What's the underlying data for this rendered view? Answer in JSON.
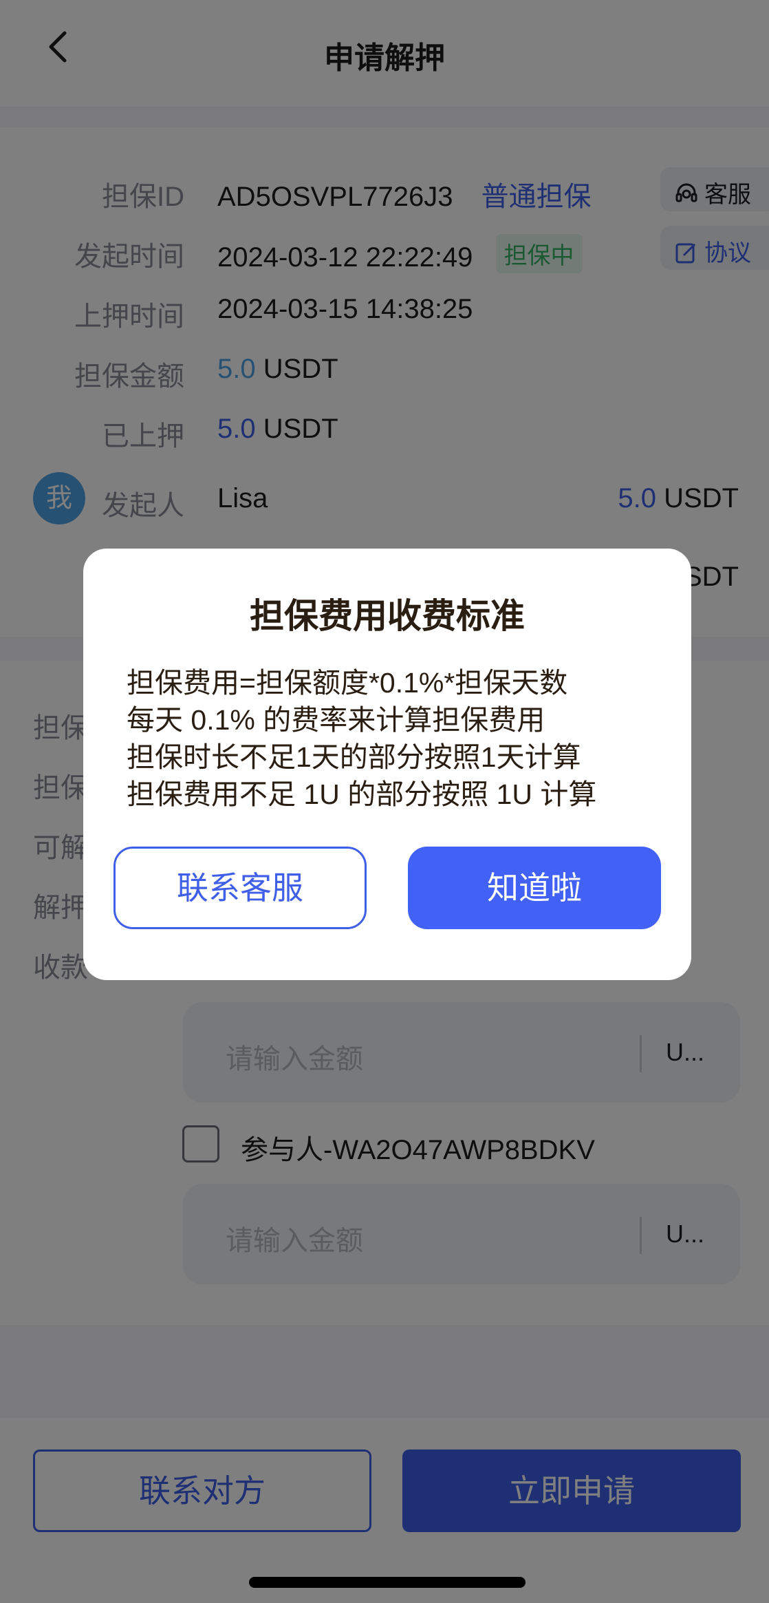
{
  "nav": {
    "title": "申请解押"
  },
  "info": {
    "guarantee_id_label": "担保ID",
    "guarantee_id": "AD5OSVPL7726J3",
    "guarantee_type": "普通担保",
    "start_time_label": "发起时间",
    "start_time": "2024-03-12 22:22:49",
    "status_badge": "担保中",
    "deposit_time_label": "上押时间",
    "deposit_time": "2024-03-15 14:38:25",
    "amount_label": "担保金额",
    "amount_value": "5.0",
    "amount_unit": "USDT",
    "deposited_label": "已上押",
    "deposited_value": "5.0",
    "deposited_unit": "USDT",
    "initiator_avatar": "我",
    "initiator_label": "发起人",
    "initiator_name": "Lisa",
    "initiator_amount": "5.0",
    "initiator_unit": "USDT",
    "partial_unit": "SDT",
    "service_button": "客服",
    "agreement_button": "协议"
  },
  "form": {
    "label_1": "担保",
    "label_2": "担保",
    "label_3": "可解",
    "label_4": "解押",
    "label_5": "收款",
    "amount_placeholder": "请输入金额",
    "amount_unit": "U...",
    "participant": "参与人-WA2O47AWP8BDKV",
    "amount_placeholder_2": "请输入金额",
    "amount_unit_2": "U..."
  },
  "bottom": {
    "contact_button": "联系对方",
    "apply_button": "立即申请"
  },
  "dialog": {
    "title": "担保费用收费标准",
    "lines": [
      "担保费用=担保额度*0.1%*担保天数",
      "每天 0.1% 的费率来计算担保费用",
      "担保时长不足1天的部分按照1天计算",
      "担保费用不足 1U 的部分按照 1U 计算"
    ],
    "contact_service_button": "联系客服",
    "ok_button": "知道啦"
  },
  "colors": {
    "accent": "#3f5fe8",
    "status_green": "#36b366",
    "amount_light_blue": "#4fa3e6"
  }
}
